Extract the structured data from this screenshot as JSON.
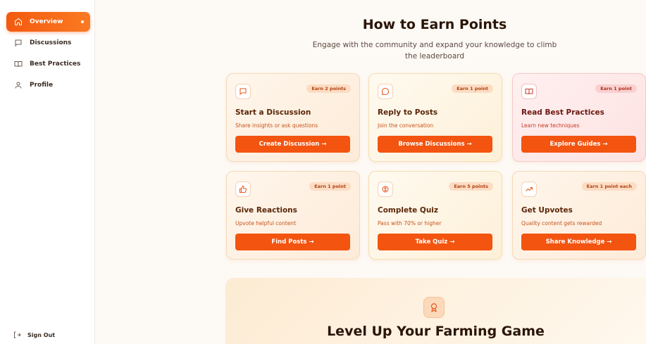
{
  "sidebar": {
    "items": [
      {
        "label": "Overview",
        "icon": "home-icon",
        "active": true
      },
      {
        "label": "Discussions",
        "icon": "chat-icon"
      },
      {
        "label": "Best Practices",
        "icon": "book-icon"
      },
      {
        "label": "Profile",
        "icon": "user-icon"
      }
    ],
    "signout_label": "Sign Out"
  },
  "main": {
    "title": "How to Earn Points",
    "subtitle": "Engage with the community and expand your knowledge to climb the leaderboard",
    "cards": [
      {
        "title": "Start a Discussion",
        "desc": "Share insights or ask questions",
        "badge": "Earn 2 points",
        "button": "Create Discussion →",
        "icon": "message-square-icon"
      },
      {
        "title": "Reply to Posts",
        "desc": "Join the conversation",
        "badge": "Earn 1 point",
        "button": "Browse Discussions →",
        "icon": "message-circle-icon"
      },
      {
        "title": "Read Best Practices",
        "desc": "Learn new techniques",
        "badge": "Earn 1 point",
        "button": "Explore Guides →",
        "icon": "book-open-icon"
      },
      {
        "title": "Give Reactions",
        "desc": "Upvote helpful content",
        "badge": "Earn 1 point",
        "button": "Find Posts →",
        "icon": "thumbs-up-icon"
      },
      {
        "title": "Complete Quiz",
        "desc": "Pass with 70% or higher",
        "badge": "Earn 5 points",
        "button": "Take Quiz →",
        "icon": "brain-icon"
      },
      {
        "title": "Get Upvotes",
        "desc": "Quality content gets rewarded",
        "badge": "Earn 1 point each",
        "button": "Share Knowledge →",
        "icon": "trending-up-icon"
      }
    ],
    "promo": {
      "title": "Level Up Your Farming Game",
      "icon": "award-icon"
    }
  },
  "colors": {
    "accent": "#f35410",
    "badge_bg": "#fcdcc3",
    "page_bg": "#fdf9f4"
  }
}
